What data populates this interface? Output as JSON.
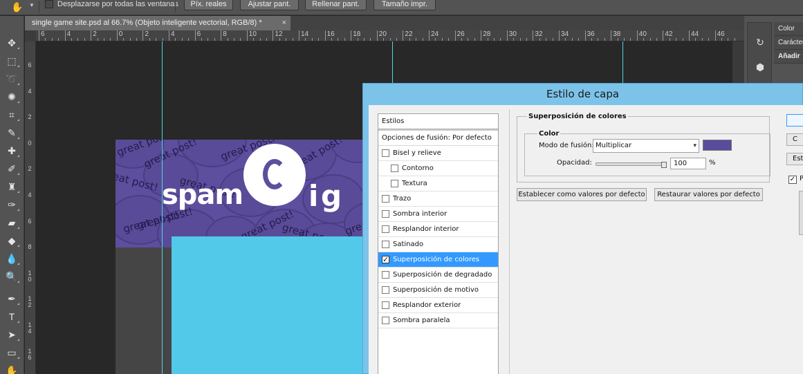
{
  "options_bar": {
    "scroll_all_label": "Desplazarse por todas las ventanas",
    "buttons": [
      "Píx. reales",
      "Ajustar pant.",
      "Rellenar pant.",
      "Tamaño impr."
    ]
  },
  "document": {
    "tab_title": "single game site.psd al 66.7% (Objeto inteligente vectorial, RGB/8) *",
    "close_glyph": "×"
  },
  "rulers": {
    "horizontal": [
      "6",
      "4",
      "2",
      "0",
      "2",
      "4",
      "6",
      "8",
      "10",
      "12",
      "14",
      "16",
      "18",
      "20",
      "22",
      "24",
      "26",
      "28",
      "30",
      "32",
      "34",
      "36",
      "38",
      "40",
      "42",
      "44",
      "46"
    ],
    "vertical": [
      "6",
      "4",
      "2",
      "0",
      "2",
      "4",
      "6",
      "8",
      "10",
      "12",
      "14",
      "16"
    ]
  },
  "artwork": {
    "logo_text": "spam",
    "logo_i": "i",
    "logo_g": "g",
    "pattern_text": "great post!",
    "colors": {
      "purple": "#5e4e9e",
      "cyan": "#53c9ea"
    }
  },
  "right_panel": {
    "tabs": [
      "Color",
      "Carácter",
      "Añadir"
    ]
  },
  "dialog": {
    "title": "Estilo de capa",
    "styles_header": "Estilos",
    "blend_options": "Opciones de fusión: Por defecto",
    "style_items": [
      {
        "label": "Bisel y relieve",
        "checked": false,
        "indent": false,
        "selected": false
      },
      {
        "label": "Contorno",
        "checked": false,
        "indent": true,
        "selected": false
      },
      {
        "label": "Textura",
        "checked": false,
        "indent": true,
        "selected": false
      },
      {
        "label": "Trazo",
        "checked": false,
        "indent": false,
        "selected": false
      },
      {
        "label": "Sombra interior",
        "checked": false,
        "indent": false,
        "selected": false
      },
      {
        "label": "Resplandor interior",
        "checked": false,
        "indent": false,
        "selected": false
      },
      {
        "label": "Satinado",
        "checked": false,
        "indent": false,
        "selected": false
      },
      {
        "label": "Superposición de colores",
        "checked": true,
        "indent": false,
        "selected": true
      },
      {
        "label": "Superposición de degradado",
        "checked": false,
        "indent": false,
        "selected": false
      },
      {
        "label": "Superposición de motivo",
        "checked": false,
        "indent": false,
        "selected": false
      },
      {
        "label": "Resplandor exterior",
        "checked": false,
        "indent": false,
        "selected": false
      },
      {
        "label": "Sombra paralela",
        "checked": false,
        "indent": false,
        "selected": false
      }
    ],
    "section_title": "Superposición de colores",
    "color_group_title": "Color",
    "blend_mode_label": "Modo de fusión:",
    "blend_mode_value": "Multiplicar",
    "overlay_color": "#594c9c",
    "opacity_label": "Opacidad:",
    "opacity_value": "100",
    "opacity_unit": "%",
    "opacity_fraction": 1.0,
    "set_default_button": "Establecer como valores por defecto",
    "reset_default_button": "Restaurar valores por defecto",
    "side_buttons": [
      "",
      "C",
      "Esti"
    ],
    "preview_label": "Pr",
    "preview_checked": true
  }
}
